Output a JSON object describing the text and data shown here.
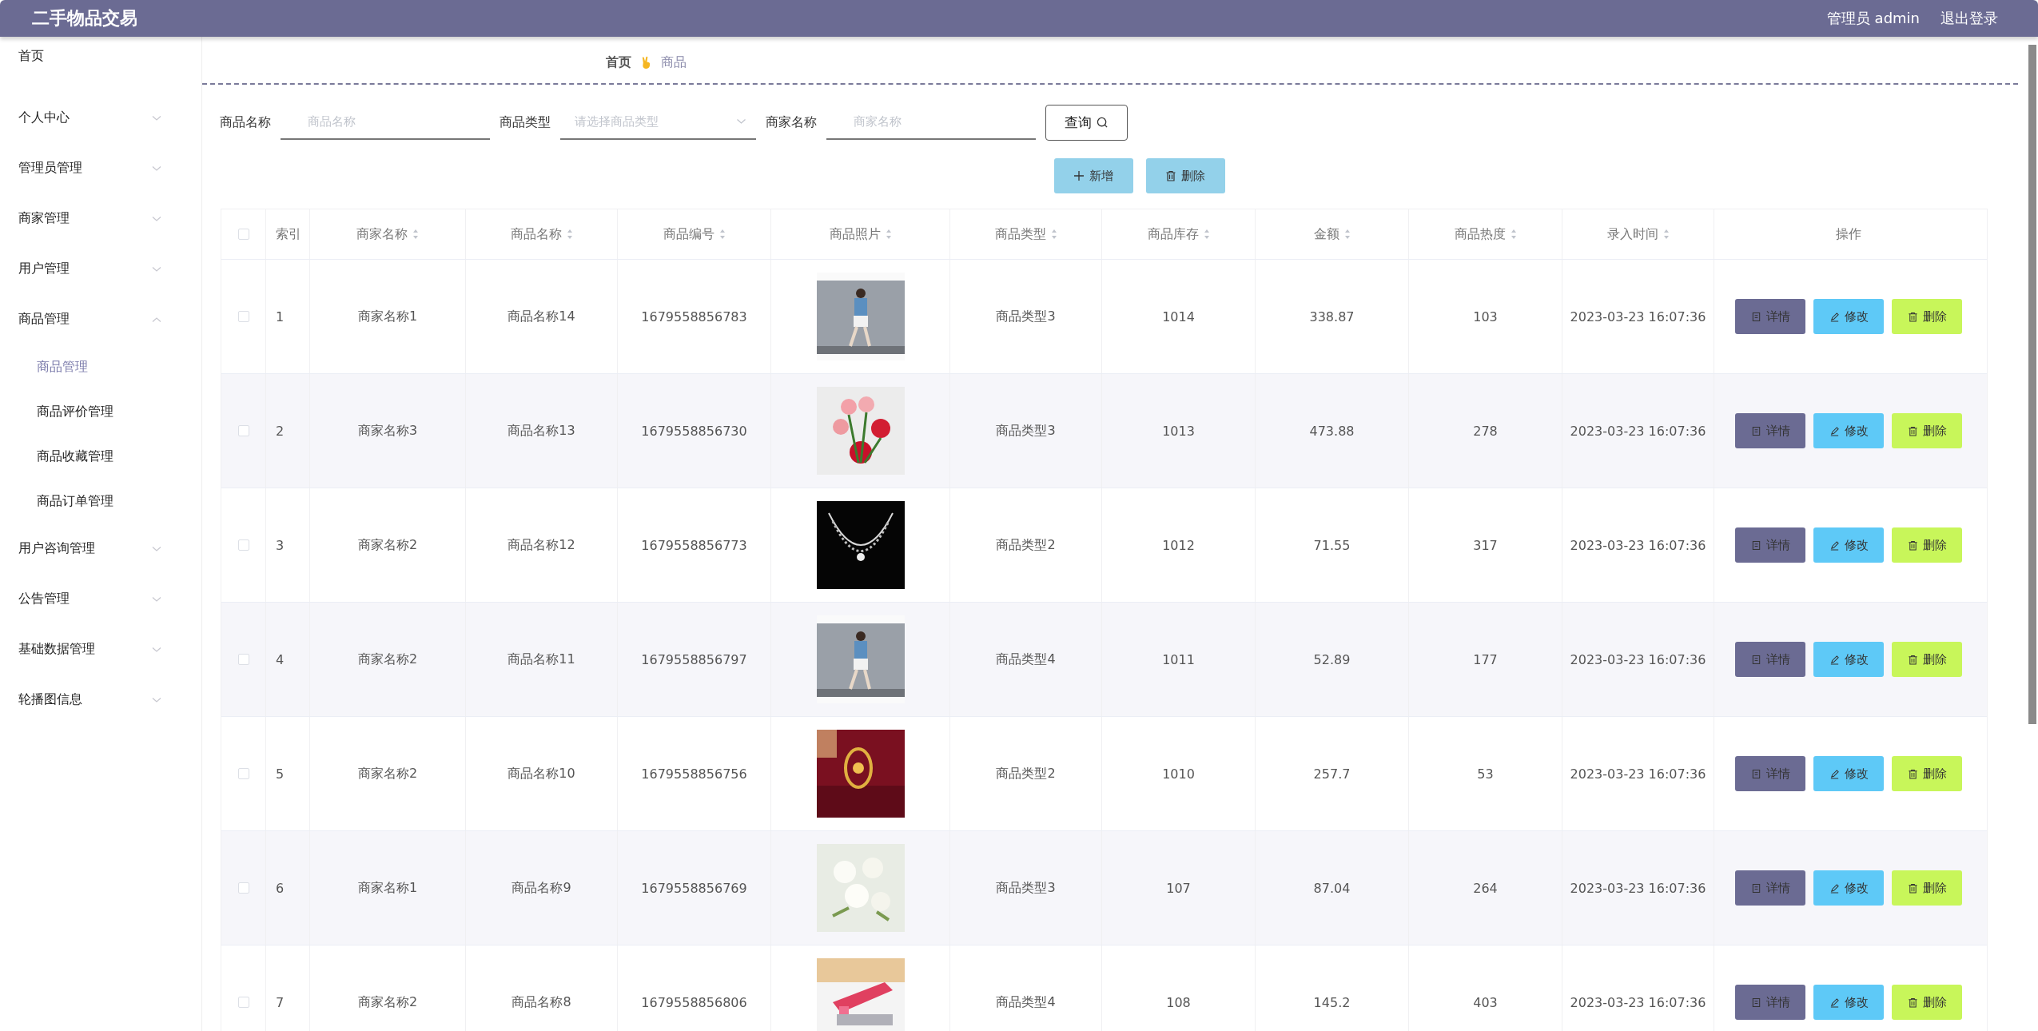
{
  "header": {
    "title": "二手物品交易",
    "user": "管理员 admin",
    "logout": "退出登录"
  },
  "sidebar": {
    "items": [
      {
        "label": "首页",
        "kind": "link"
      },
      {
        "label": "个人中心",
        "kind": "group",
        "expanded": false
      },
      {
        "label": "管理员管理",
        "kind": "group",
        "expanded": false
      },
      {
        "label": "商家管理",
        "kind": "group",
        "expanded": false
      },
      {
        "label": "用户管理",
        "kind": "group",
        "expanded": false
      },
      {
        "label": "商品管理",
        "kind": "group",
        "expanded": true,
        "children": [
          {
            "label": "商品管理",
            "selected": true
          },
          {
            "label": "商品评价管理",
            "selected": false
          },
          {
            "label": "商品收藏管理",
            "selected": false
          },
          {
            "label": "商品订单管理",
            "selected": false
          }
        ]
      },
      {
        "label": "用户咨询管理",
        "kind": "group",
        "expanded": false
      },
      {
        "label": "公告管理",
        "kind": "group",
        "expanded": false
      },
      {
        "label": "基础数据管理",
        "kind": "group",
        "expanded": false
      },
      {
        "label": "轮播图信息",
        "kind": "group",
        "expanded": false
      }
    ]
  },
  "breadcrumb": [
    "首页",
    "商品"
  ],
  "search": {
    "fields": [
      {
        "label": "商品名称",
        "kind": "input",
        "placeholder": "商品名称"
      },
      {
        "label": "商品类型",
        "kind": "select",
        "placeholder": "请选择商品类型"
      },
      {
        "label": "商家名称",
        "kind": "input",
        "placeholder": "商家名称"
      }
    ],
    "button": "查询"
  },
  "actions": [
    "新增",
    "删除"
  ],
  "table": {
    "header_checked": false,
    "columns": [
      {
        "label": "索引",
        "sortable": false
      },
      {
        "label": "商家名称",
        "sortable": true
      },
      {
        "label": "商品名称",
        "sortable": true
      },
      {
        "label": "商品编号",
        "sortable": true
      },
      {
        "label": "商品照片",
        "sortable": true
      },
      {
        "label": "商品类型",
        "sortable": true
      },
      {
        "label": "商品库存",
        "sortable": true
      },
      {
        "label": "金额",
        "sortable": true
      },
      {
        "label": "商品热度",
        "sortable": true
      },
      {
        "label": "录入时间",
        "sortable": true
      },
      {
        "label": "操作",
        "sortable": false
      }
    ],
    "rows": [
      {
        "checked": false,
        "cells": [
          "1",
          "商家名称1",
          "商品名称14",
          "1679558856783",
          null,
          "商品类型3",
          "1014",
          "338.87",
          "103",
          "2023-03-23 16:07:36"
        ],
        "buttons": [
          "详情",
          "修改",
          "删除"
        ]
      },
      {
        "checked": false,
        "cells": [
          "2",
          "商家名称3",
          "商品名称13",
          "1679558856730",
          null,
          "商品类型3",
          "1013",
          "473.88",
          "278",
          "2023-03-23 16:07:36"
        ],
        "buttons": [
          "详情",
          "修改",
          "删除"
        ]
      },
      {
        "checked": false,
        "cells": [
          "3",
          "商家名称2",
          "商品名称12",
          "1679558856773",
          null,
          "商品类型2",
          "1012",
          "71.55",
          "317",
          "2023-03-23 16:07:36"
        ],
        "buttons": [
          "详情",
          "修改",
          "删除"
        ]
      },
      {
        "checked": false,
        "cells": [
          "4",
          "商家名称2",
          "商品名称11",
          "1679558856797",
          null,
          "商品类型4",
          "1011",
          "52.89",
          "177",
          "2023-03-23 16:07:36"
        ],
        "buttons": [
          "详情",
          "修改",
          "删除"
        ]
      },
      {
        "checked": false,
        "cells": [
          "5",
          "商家名称2",
          "商品名称10",
          "1679558856756",
          null,
          "商品类型2",
          "1010",
          "257.7",
          "53",
          "2023-03-23 16:07:36"
        ],
        "buttons": [
          "详情",
          "修改",
          "删除"
        ]
      },
      {
        "checked": false,
        "cells": [
          "6",
          "商家名称1",
          "商品名称9",
          "1679558856769",
          null,
          "商品类型3",
          "107",
          "87.04",
          "264",
          "2023-03-23 16:07:36"
        ],
        "buttons": [
          "详情",
          "修改",
          "删除"
        ]
      },
      {
        "checked": false,
        "cells": [
          "7",
          "商家名称2",
          "商品名称8",
          "1679558856806",
          null,
          "商品类型4",
          "108",
          "145.2",
          "403",
          "2023-03-23 16:07:36"
        ],
        "buttons": [
          "详情",
          "修改",
          "删除"
        ]
      }
    ]
  }
}
